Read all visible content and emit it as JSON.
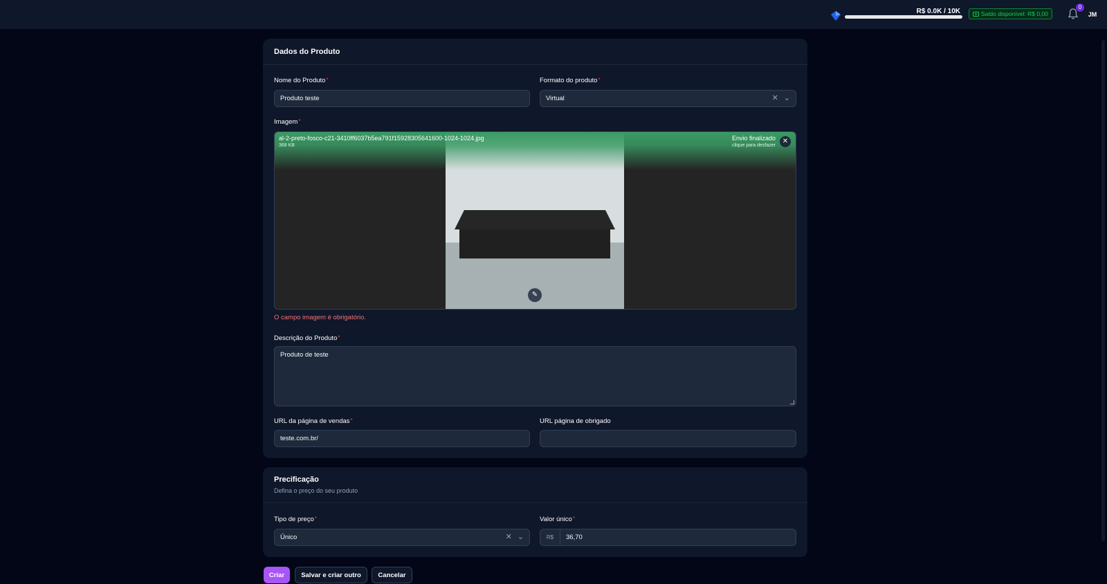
{
  "topbar": {
    "progress_label": "R$ 0.0K / 10K",
    "progress_fraction": 0.0,
    "balance_label": "Saldo disponível: R$ 0,00",
    "notification_count": "0",
    "avatar_initials": "JM"
  },
  "product": {
    "section_title": "Dados do Produto",
    "name_label": "Nome do Produto",
    "name_value": "Produto teste",
    "format_label": "Formato do produto",
    "format_value": "Virtual",
    "image_label": "Imagem",
    "file_name": "al-2-preto-fosco-c21-3410ff6037b5ea791f15928305641600-1024-1024.jpg",
    "file_size": "368 KB",
    "upload_status": "Envio finalizado",
    "upload_hint": "clique para desfazer",
    "image_error": "O campo imagem é obrigatório.",
    "description_label": "Descrição do Produto",
    "description_value": "Produto de teste",
    "sales_url_label": "URL da página de vendas",
    "sales_url_value": "teste.com.br/",
    "thanks_url_label": "URL página de obrigado",
    "thanks_url_value": "",
    "required_marker": "*"
  },
  "pricing": {
    "section_title": "Precificação",
    "section_subtitle": "Defina o preço do seu produto",
    "price_type_label": "Tipo de preço",
    "price_type_value": "Único",
    "single_value_label": "Valor único",
    "currency_prefix": "R$",
    "single_value": "36,70"
  },
  "actions": {
    "create": "Criar",
    "save_create_another": "Salvar e criar outro",
    "cancel": "Cancelar"
  },
  "icons": {
    "gem": "gem-icon",
    "wallet": "wallet-icon",
    "bell": "bell-icon",
    "clear": "clear-icon",
    "chevron": "chevron-down-icon",
    "close": "close-icon",
    "edit": "pencil-icon"
  },
  "colors": {
    "accent": "#a855f7",
    "success": "#22c55e",
    "error": "#f87171",
    "upload_overlay": "#3a9b64"
  }
}
